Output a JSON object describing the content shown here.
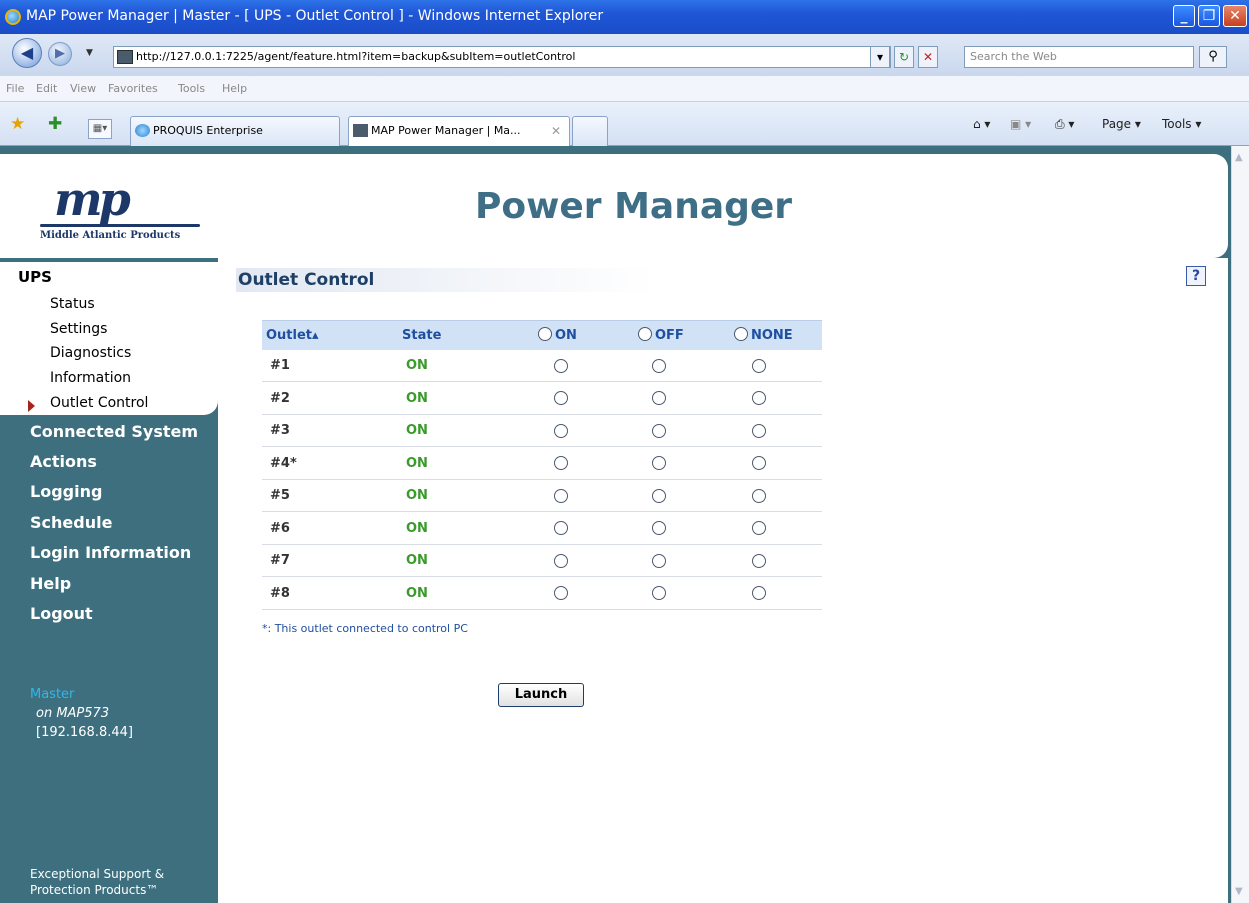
{
  "window": {
    "title": "MAP Power Manager | Master - [ UPS - Outlet Control ] - Windows Internet Explorer",
    "min": "_",
    "max": "❐",
    "close": "✕"
  },
  "address": {
    "url": "http://127.0.0.1:7225/agent/feature.html?item=backup&subItem=outletControl",
    "search_placeholder": "Search the Web"
  },
  "menu": [
    "File",
    "Edit",
    "View",
    "Favorites",
    "Tools",
    "Help"
  ],
  "tabs": [
    {
      "label": "PROQUIS Enterprise"
    },
    {
      "label": "MAP Power Manager | Ma...",
      "active": true,
      "close": "✕"
    }
  ],
  "commandbar": {
    "page": "Page ▾",
    "tools": "Tools ▾"
  },
  "header": {
    "logo_text": "Middle Atlantic Products",
    "title": "Power Manager"
  },
  "sidebar": {
    "section": "UPS",
    "subitems": [
      "Status",
      "Settings",
      "Diagnostics",
      "Information",
      "Outlet Control"
    ],
    "active_subitem": "Outlet Control",
    "links": [
      "Connected System",
      "Actions",
      "Logging",
      "Schedule",
      "Login Information",
      "Help",
      "Logout"
    ],
    "agent": {
      "name": "Master",
      "host": "on MAP573",
      "ip": "[192.168.8.44]"
    },
    "footer_line1": "Exceptional Support &",
    "footer_line2": "Protection Products™"
  },
  "content": {
    "section_title": "Outlet Control",
    "help_label": "?",
    "columns": {
      "outlet": "Outlet▴",
      "state": "State",
      "on": "ON",
      "off": "OFF",
      "none": "NONE"
    },
    "rows": [
      {
        "outlet": "#1",
        "state": "ON"
      },
      {
        "outlet": "#2",
        "state": "ON"
      },
      {
        "outlet": "#3",
        "state": "ON"
      },
      {
        "outlet": "#4*",
        "state": "ON"
      },
      {
        "outlet": "#5",
        "state": "ON"
      },
      {
        "outlet": "#6",
        "state": "ON"
      },
      {
        "outlet": "#7",
        "state": "ON"
      },
      {
        "outlet": "#8",
        "state": "ON"
      }
    ],
    "note": "*: This outlet connected to control PC",
    "launch_label": "Launch"
  },
  "colors": {
    "accent": "#3e6f86",
    "sidebar_bg": "#3d6f7f",
    "state_on": "#3a9a2a",
    "table_header": "#d2e2f6"
  }
}
